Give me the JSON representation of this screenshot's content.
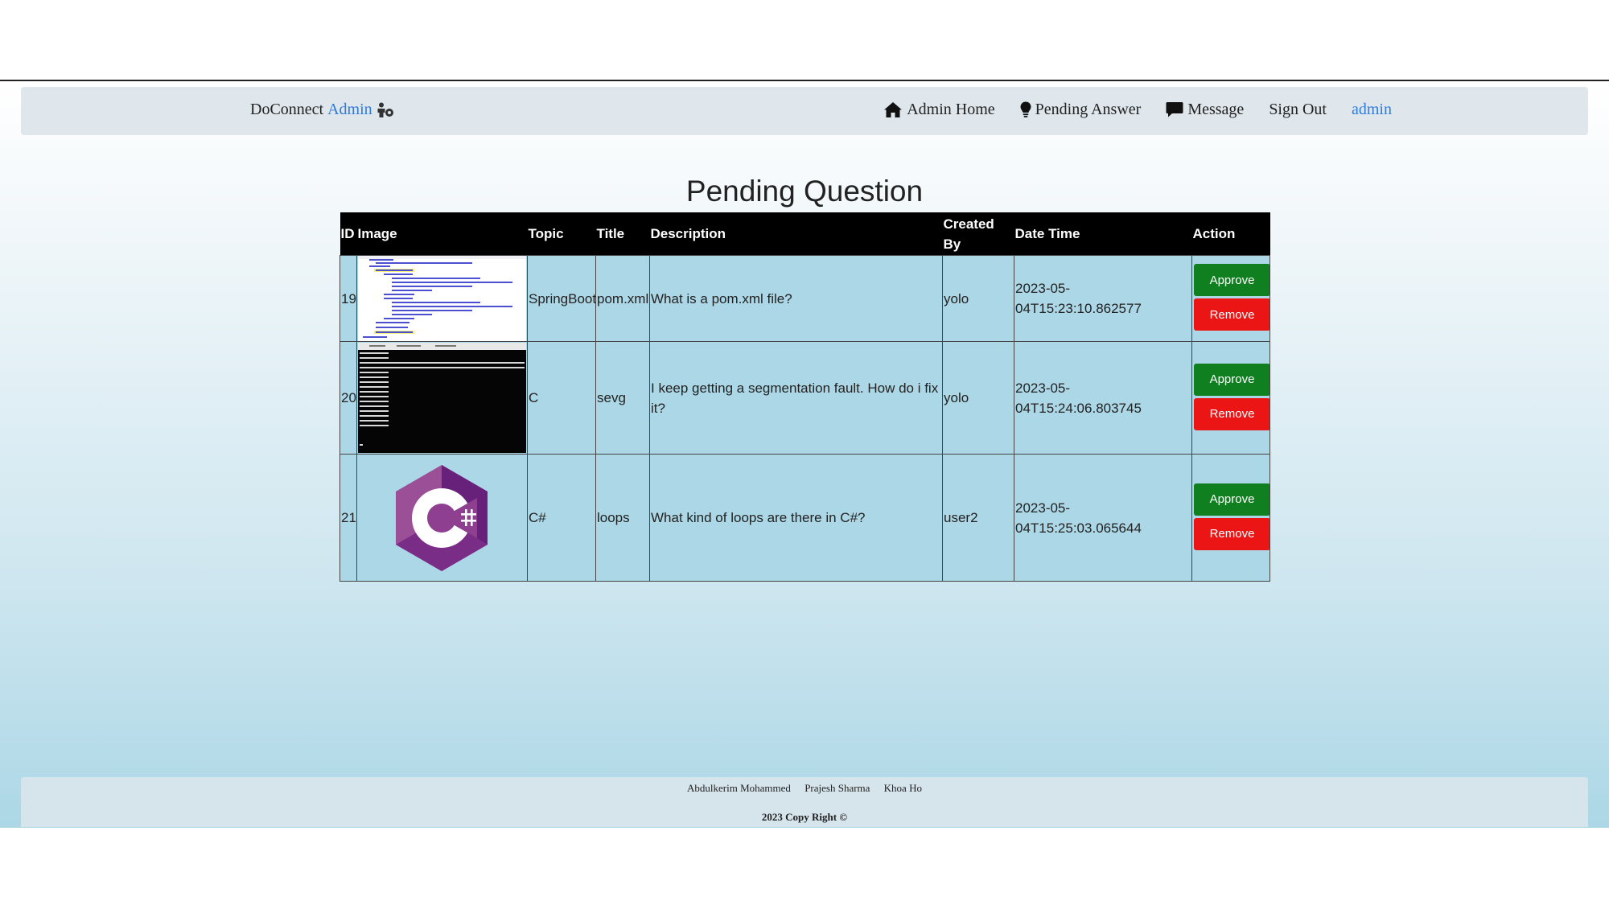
{
  "navbar": {
    "brand": "DoConnect",
    "brand_role": "Admin",
    "brand_icon": "admin-user-icon",
    "links": [
      {
        "label": "Admin Home",
        "icon": "home-icon"
      },
      {
        "label": "Pending Answer",
        "icon": "lightbulb-icon"
      },
      {
        "label": "Message",
        "icon": "message-icon"
      },
      {
        "label": "Sign Out"
      }
    ],
    "user": "admin",
    "link_color": "#2f7bd8"
  },
  "page_title": "Pending Question",
  "table": {
    "headers": {
      "id": "ID",
      "image": "Image",
      "topic": "Topic",
      "title": "Title",
      "description": "Description",
      "created_by": "Created By",
      "date_time": "Date Time",
      "action": "Action"
    },
    "rows": [
      {
        "id": "19",
        "image": "pom-xml-screenshot",
        "topic": "SpringBoot",
        "title": "pom.xml",
        "description": "What is a pom.xml file?",
        "created_by": "yolo",
        "date_time": "2023-05-04T15:23:10.862577"
      },
      {
        "id": "20",
        "image": "terminal-segfault-screenshot",
        "topic": "C",
        "title": "sevg",
        "description": "I keep getting a segmentation fault. How do i fix it?",
        "created_by": "yolo",
        "date_time": "2023-05-04T15:24:06.803745"
      },
      {
        "id": "21",
        "image": "csharp-logo",
        "topic": "C#",
        "title": "loops",
        "description": "What kind of loops are there in C#?",
        "created_by": "user2",
        "date_time": "2023-05-04T15:25:03.065644"
      }
    ],
    "approve_label": "Approve",
    "remove_label": "Remove",
    "header_bg": "#000000",
    "row_bg": "#acd7e6"
  },
  "colors": {
    "approve": "#0f7f1f",
    "remove": "#ec1515"
  },
  "footer": {
    "authors": [
      "Abdulkerim Mohammed",
      "Prajesh Sharma",
      "Khoa Ho"
    ],
    "copyright": "2023 Copy Right ©"
  }
}
